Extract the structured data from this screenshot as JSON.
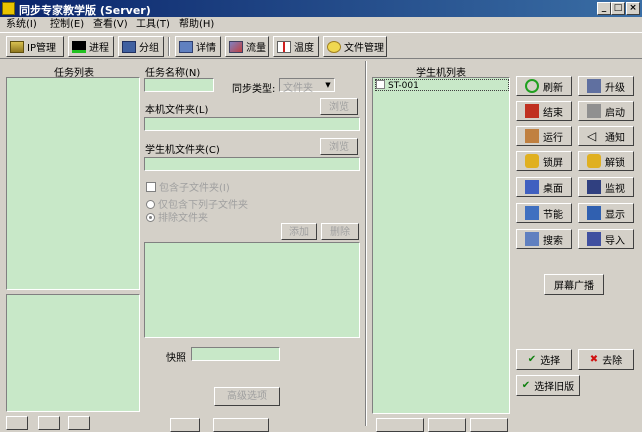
{
  "window": {
    "title": "同步专家教学版 (Server)",
    "minimize": "_",
    "maximize": "□",
    "close": "×"
  },
  "menu": [
    "系统(I)",
    "控制(E)",
    "查看(V)",
    "工具(T)",
    "帮助(H)"
  ],
  "toolbar": [
    {
      "label": "IP管理",
      "icon": "ip-icon"
    },
    {
      "label": "进程",
      "icon": "process-icon"
    },
    {
      "label": "分组",
      "icon": "group-icon"
    },
    {
      "label": "详情",
      "icon": "detail-icon"
    },
    {
      "label": "流量",
      "icon": "traffic-icon"
    },
    {
      "label": "温度",
      "icon": "temperature-icon"
    },
    {
      "label": "文件管理",
      "icon": "file-manage-icon"
    }
  ],
  "left": {
    "task_list_title": "任务列表"
  },
  "task": {
    "name_label": "任务名称(N)",
    "sync_type_label": "同步类型:",
    "sync_type_value": "文件夹",
    "local_folder_label": "本机文件夹(L)",
    "browse_label": "浏览",
    "student_folder_label": "学生机文件夹(C)",
    "include_subfolders": "包含子文件夹(I)",
    "only_subfolder_files": "仅包含下列子文件夹",
    "exclude_subfolders": "排除文件夹",
    "add_label": "添加",
    "delete_label": "删除",
    "snapshot_label": "快照",
    "advanced_label": "高级选项"
  },
  "students": {
    "title": "学生机列表",
    "items": [
      "ST-001"
    ]
  },
  "actions": [
    {
      "label": "刷新",
      "icon": "refresh-icon"
    },
    {
      "label": "升级",
      "icon": "upgrade-icon"
    },
    {
      "label": "结束",
      "icon": "end-icon"
    },
    {
      "label": "启动",
      "icon": "start-icon"
    },
    {
      "label": "运行",
      "icon": "run-icon"
    },
    {
      "label": "通知",
      "icon": "notify-icon"
    },
    {
      "label": "锁屏",
      "icon": "lock-icon"
    },
    {
      "label": "解锁",
      "icon": "unlock-icon"
    },
    {
      "label": "桌面",
      "icon": "desktop-icon"
    },
    {
      "label": "监视",
      "icon": "monitor-icon"
    },
    {
      "label": "节能",
      "icon": "power-save-icon"
    },
    {
      "label": "显示",
      "icon": "display-icon"
    },
    {
      "label": "搜索",
      "icon": "search-icon"
    },
    {
      "label": "导入",
      "icon": "import-icon"
    }
  ],
  "broadcast_label": "屏幕广播",
  "select_label": "选择",
  "remove_label": "去除",
  "select_old_label": "选择旧版"
}
